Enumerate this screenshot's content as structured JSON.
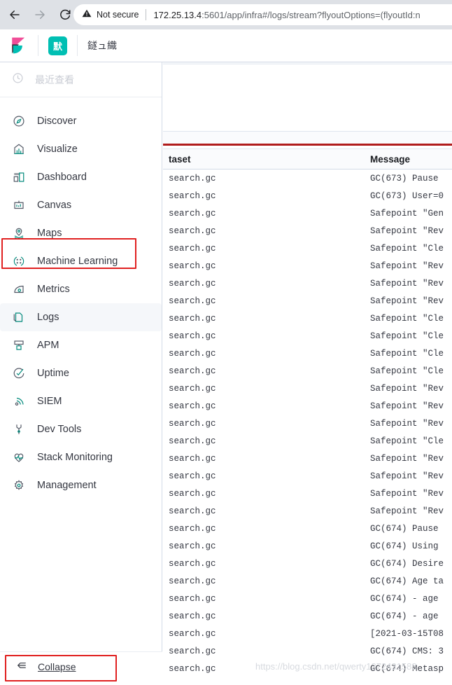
{
  "browser": {
    "back_icon": "arrow-left-icon",
    "forward_icon": "arrow-right-icon",
    "reload_icon": "reload-icon",
    "security_icon": "warning-triangle-icon",
    "security_label": "Not secure",
    "url_host": "172.25.13.4",
    "url_path": ":5601/app/infra#/logs/stream?flyoutOptions=(flyoutId:n"
  },
  "header": {
    "logo_icon": "kibana-logo-icon",
    "space_badge": "默",
    "title": "鐩ュ織",
    "accent_color": "#00bfb3"
  },
  "sidebar": {
    "recent": {
      "icon": "clock-icon",
      "label": "最近查看"
    },
    "items": [
      {
        "label": "Discover",
        "icon": "discover-compass-icon",
        "active": false
      },
      {
        "label": "Visualize",
        "icon": "visualize-bar-chart-icon",
        "active": false
      },
      {
        "label": "Dashboard",
        "icon": "dashboard-grid-icon",
        "active": false
      },
      {
        "label": "Canvas",
        "icon": "canvas-presentation-icon",
        "active": false
      },
      {
        "label": "Maps",
        "icon": "maps-pin-icon",
        "active": false
      },
      {
        "label": "Machine Learning",
        "icon": "machine-learning-icon",
        "active": false
      },
      {
        "label": "Metrics",
        "icon": "metrics-icon",
        "active": false
      },
      {
        "label": "Logs",
        "icon": "logs-document-icon",
        "active": true
      },
      {
        "label": "APM",
        "icon": "apm-icon",
        "active": false
      },
      {
        "label": "Uptime",
        "icon": "uptime-check-icon",
        "active": false
      },
      {
        "label": "SIEM",
        "icon": "siem-signal-icon",
        "active": false
      },
      {
        "label": "Dev Tools",
        "icon": "wrench-icon",
        "active": false
      },
      {
        "label": "Stack Monitoring",
        "icon": "heartbeat-icon",
        "active": false
      },
      {
        "label": "Management",
        "icon": "gear-icon",
        "active": false
      }
    ],
    "collapse": {
      "label": "Collapse",
      "icon": "collapse-arrow-icon"
    },
    "highlight_color": "#e02020"
  },
  "log_table": {
    "columns": {
      "dataset": "taset",
      "message": "Message"
    },
    "rows": [
      {
        "dataset": "search.gc",
        "message": "GC(673) Pause"
      },
      {
        "dataset": "search.gc",
        "message": "GC(673) User=0"
      },
      {
        "dataset": "search.gc",
        "message": "Safepoint \"Gen"
      },
      {
        "dataset": "search.gc",
        "message": "Safepoint \"Rev"
      },
      {
        "dataset": "search.gc",
        "message": "Safepoint \"Cle"
      },
      {
        "dataset": "search.gc",
        "message": "Safepoint \"Rev"
      },
      {
        "dataset": "search.gc",
        "message": "Safepoint \"Rev"
      },
      {
        "dataset": "search.gc",
        "message": "Safepoint \"Rev"
      },
      {
        "dataset": "search.gc",
        "message": "Safepoint \"Cle"
      },
      {
        "dataset": "search.gc",
        "message": "Safepoint \"Cle"
      },
      {
        "dataset": "search.gc",
        "message": "Safepoint \"Cle"
      },
      {
        "dataset": "search.gc",
        "message": "Safepoint \"Cle"
      },
      {
        "dataset": "search.gc",
        "message": "Safepoint \"Rev"
      },
      {
        "dataset": "search.gc",
        "message": "Safepoint \"Rev"
      },
      {
        "dataset": "search.gc",
        "message": "Safepoint \"Rev"
      },
      {
        "dataset": "search.gc",
        "message": "Safepoint \"Cle"
      },
      {
        "dataset": "search.gc",
        "message": "Safepoint \"Rev"
      },
      {
        "dataset": "search.gc",
        "message": "Safepoint \"Rev"
      },
      {
        "dataset": "search.gc",
        "message": "Safepoint \"Rev"
      },
      {
        "dataset": "search.gc",
        "message": "Safepoint \"Rev"
      },
      {
        "dataset": "search.gc",
        "message": "GC(674) Pause"
      },
      {
        "dataset": "search.gc",
        "message": "GC(674) Using"
      },
      {
        "dataset": "search.gc",
        "message": "GC(674) Desire"
      },
      {
        "dataset": "search.gc",
        "message": "GC(674) Age ta"
      },
      {
        "dataset": "search.gc",
        "message": "GC(674) - age"
      },
      {
        "dataset": "search.gc",
        "message": "GC(674) - age"
      },
      {
        "dataset": "search.gc",
        "message": "[2021-03-15T08"
      },
      {
        "dataset": "search.gc",
        "message": "GC(674) CMS: 3"
      },
      {
        "dataset": "search.gc",
        "message": "GC(674) Metasp"
      }
    ]
  },
  "watermark": "https://blog.csdn.net/qwerty1372431588"
}
